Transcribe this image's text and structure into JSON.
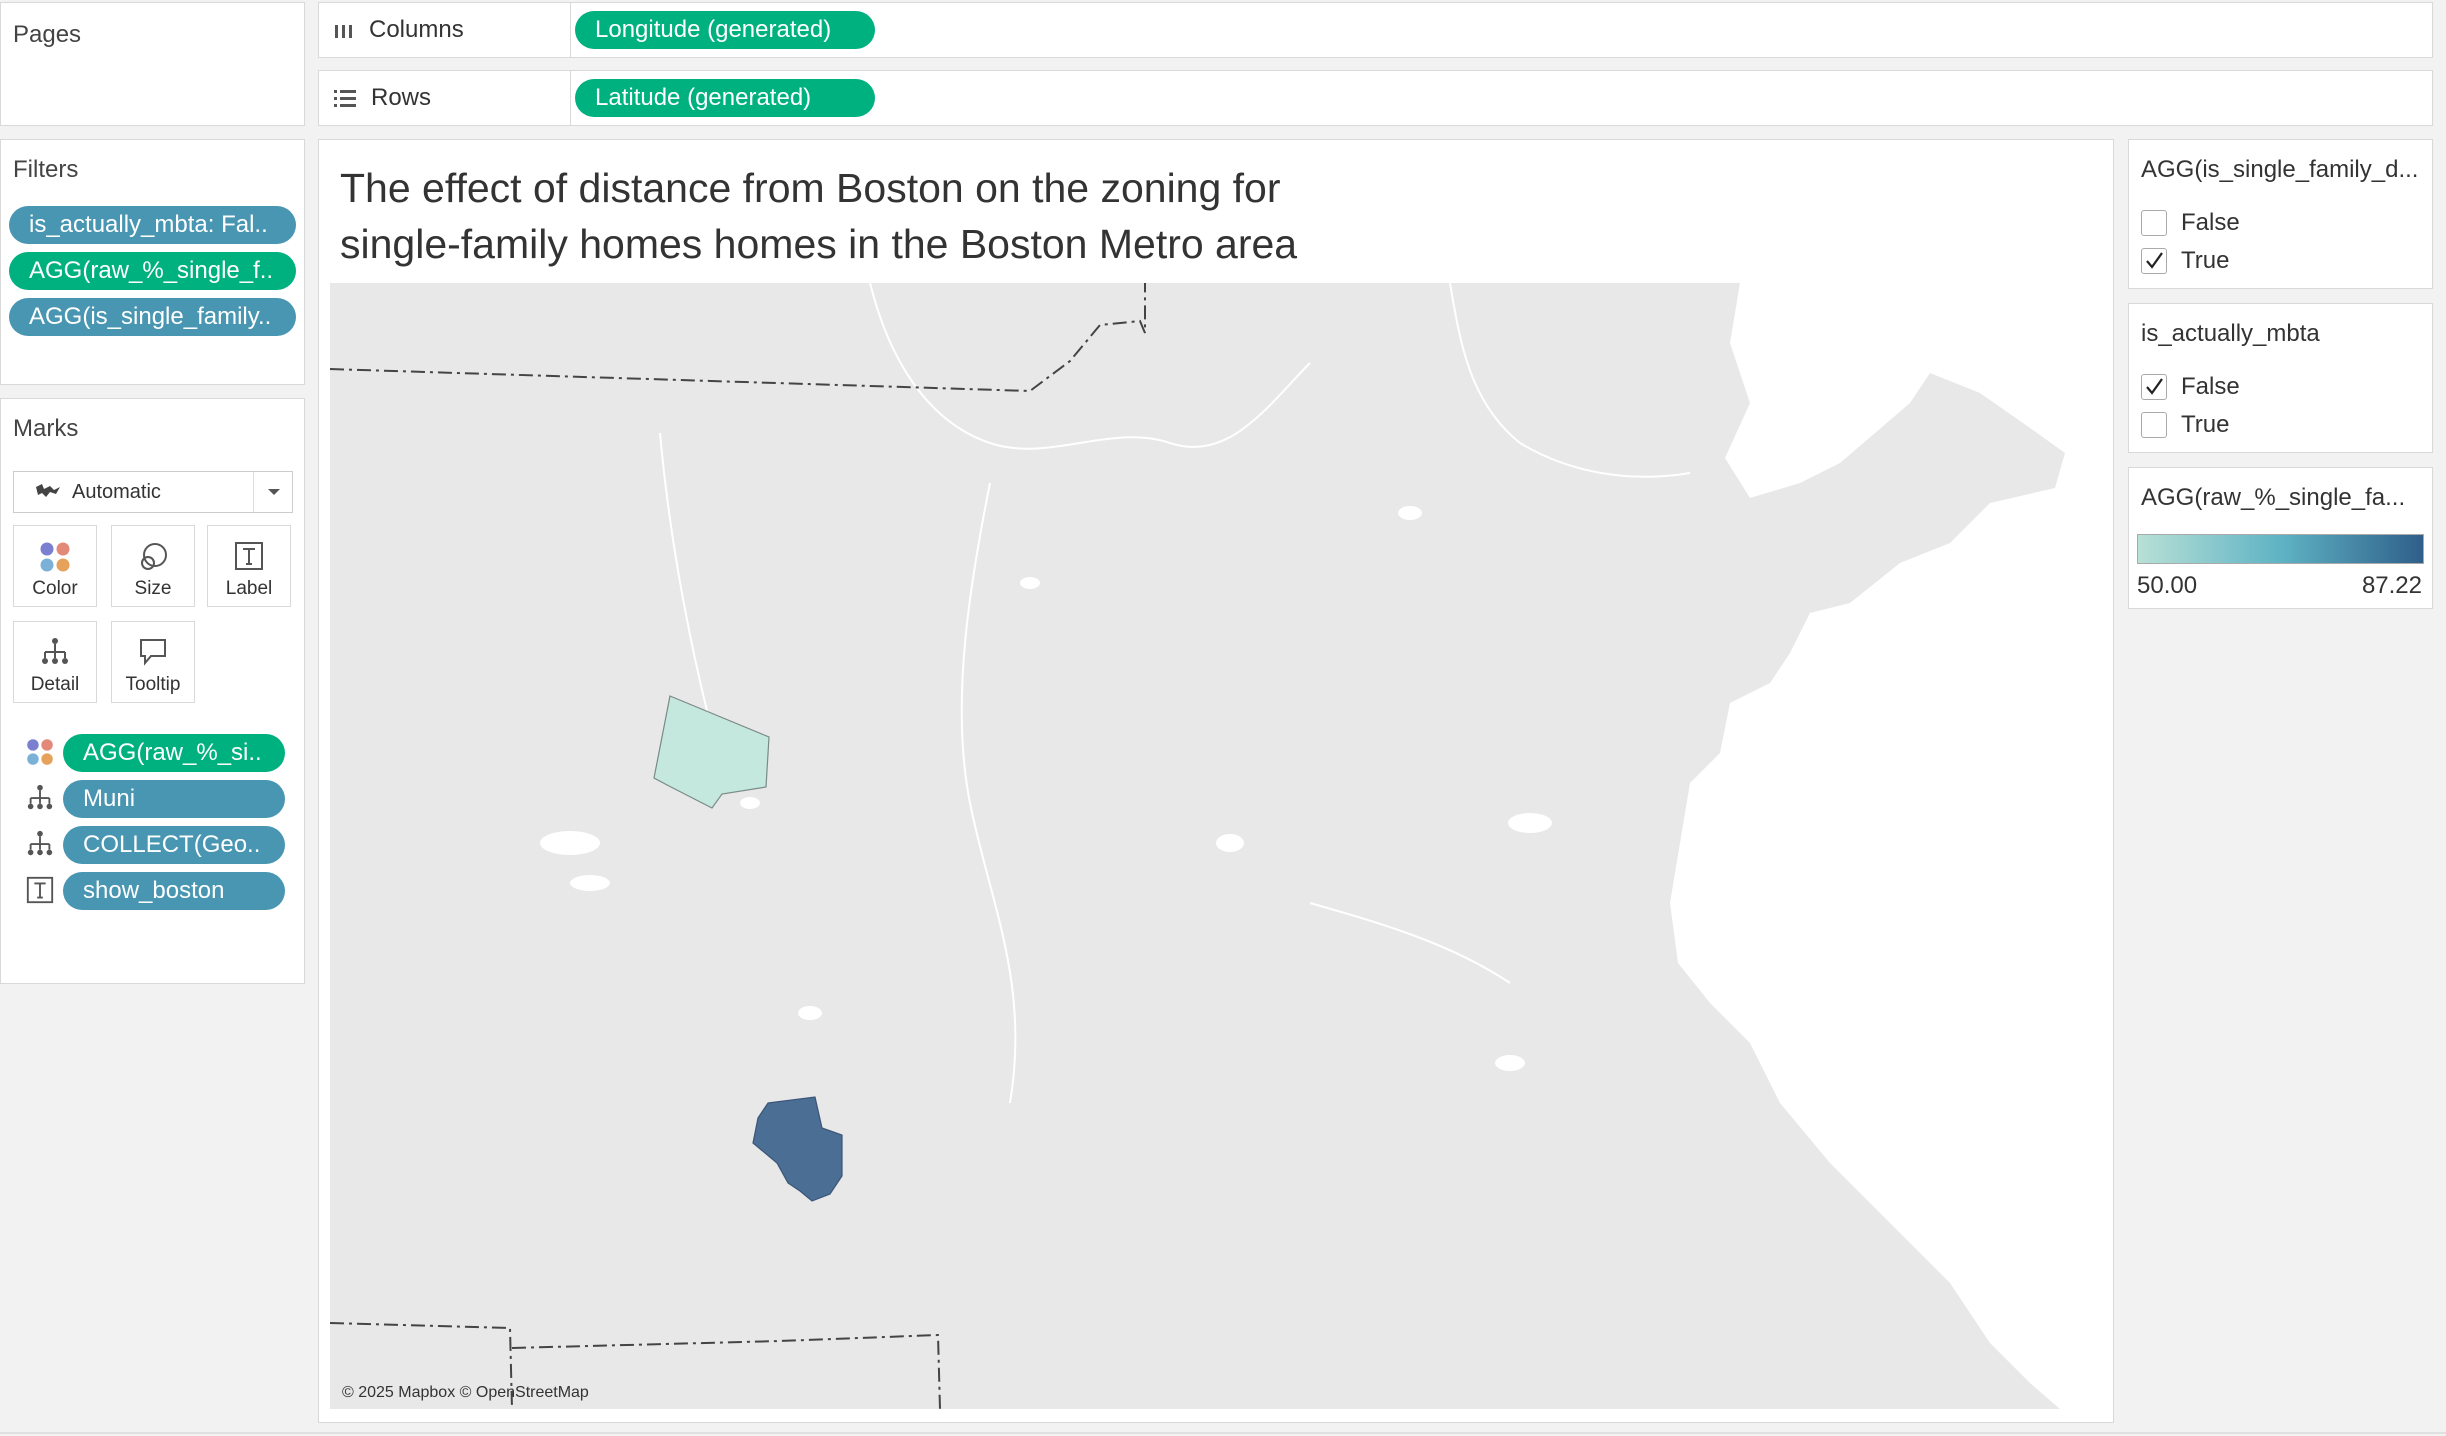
{
  "pages_panel": {
    "title": "Pages"
  },
  "columns_shelf": {
    "label": "Columns",
    "pill": "Longitude (generated)"
  },
  "rows_shelf": {
    "label": "Rows",
    "pill": "Latitude (generated)"
  },
  "filters_panel": {
    "title": "Filters",
    "pills": [
      "is_actually_mbta: Fal..",
      "AGG(raw_%_single_f..",
      "AGG(is_single_family.."
    ]
  },
  "marks_panel": {
    "title": "Marks",
    "mark_type": "Automatic",
    "buttons": [
      "Color",
      "Size",
      "Label",
      "Detail",
      "Tooltip"
    ],
    "fields": [
      "AGG(raw_%_si..",
      "Muni",
      "COLLECT(Geo..",
      "show_boston"
    ]
  },
  "viz": {
    "title_line1": "The effect of distance from Boston on the zoning for",
    "title_line2": "single-family homes homes in the Boston Metro area",
    "attribution": "© 2025 Mapbox © OpenStreetMap"
  },
  "legend_single_family": {
    "title": "AGG(is_single_family_d...",
    "options": [
      {
        "label": "False",
        "checked": false
      },
      {
        "label": "True",
        "checked": true
      }
    ]
  },
  "legend_mbta": {
    "title": "is_actually_mbta",
    "options": [
      {
        "label": "False",
        "checked": true
      },
      {
        "label": "True",
        "checked": false
      }
    ]
  },
  "legend_color": {
    "title": "AGG(raw_%_single_fa...",
    "min": "50.00",
    "max": "87.22",
    "color_low": "#b8e0d6",
    "color_high": "#2f5f8a"
  }
}
